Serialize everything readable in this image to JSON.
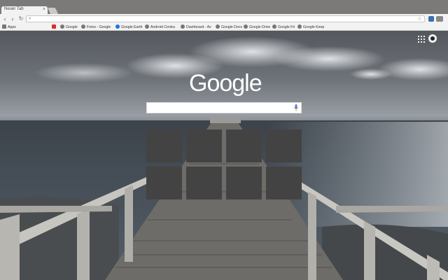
{
  "tab": {
    "title": "Neuer Tab",
    "close_glyph": "×"
  },
  "toolbar": {
    "back_glyph": "‹",
    "forward_glyph": "›",
    "reload_glyph": "↻",
    "search_glyph": "⌕",
    "star_glyph": "☆",
    "omnibox_value": ""
  },
  "bookmarks": {
    "apps_label": "Apps",
    "items": [
      {
        "label": "",
        "color": "#d93025"
      },
      {
        "label": "Google",
        "color": "#777777"
      },
      {
        "label": "Fotos - Google",
        "color": "#777777"
      },
      {
        "label": "Google Earth",
        "color": "#1a73e8"
      },
      {
        "label": "Android Centra",
        "color": "#777777"
      },
      {
        "label": "Dashboard - Av",
        "color": "#777777"
      },
      {
        "label": "Google Docs",
        "color": "#777777"
      },
      {
        "label": "Google Drive",
        "color": "#777777"
      },
      {
        "label": "Google Fit",
        "color": "#777777"
      },
      {
        "label": "Google Keep",
        "color": "#777777"
      }
    ]
  },
  "ntp": {
    "logo_text": "Google",
    "search_value": "",
    "tile_count": 8
  },
  "colors": {
    "tile": "#434343",
    "mic_blue": "#4285f4",
    "mic_red": "#ea4335"
  }
}
